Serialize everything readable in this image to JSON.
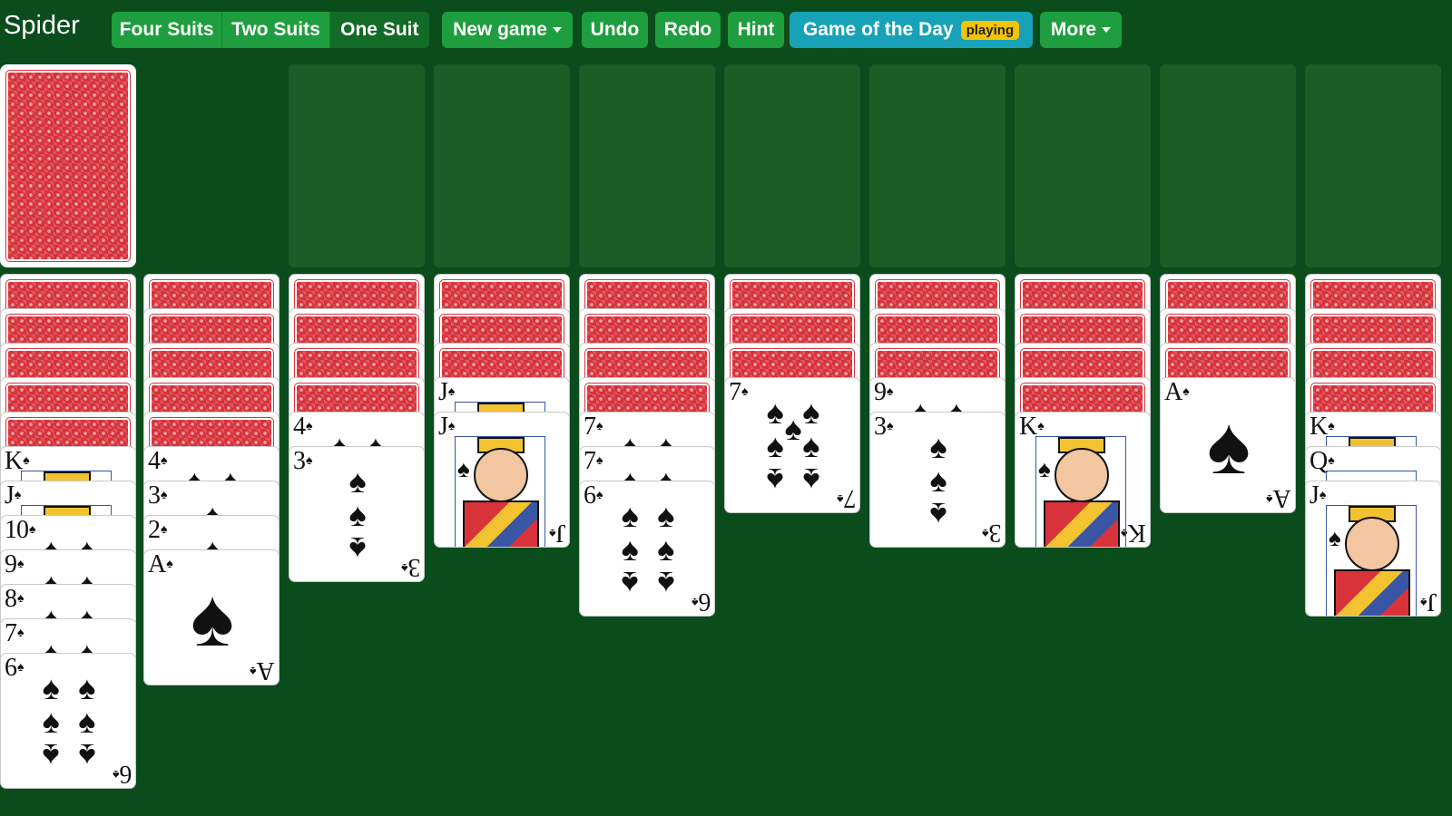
{
  "app": {
    "title": "Spider"
  },
  "toolbar": {
    "suits": [
      {
        "label": "Four Suits"
      },
      {
        "label": "Two Suits"
      },
      {
        "label": "One Suit",
        "active": true
      }
    ],
    "new_game": "New game",
    "undo": "Undo",
    "redo": "Redo",
    "hint": "Hint",
    "game_of_day": "Game of the Day",
    "game_of_day_badge": "playing",
    "more": "More"
  },
  "colors": {
    "table": "#0b4c1c",
    "button": "#1e9e3e",
    "button_active": "#136b28",
    "game_of_day": "#17a2b8",
    "badge": "#f5c400",
    "card_back": "#d8323a",
    "empty_slot": "#1c5c27"
  },
  "suit_symbol": "♠",
  "stock": {
    "face_down": true
  },
  "foundations_empty": 8,
  "tableau": [
    {
      "down": 5,
      "up": [
        "K",
        "J",
        "10",
        "9",
        "8",
        "7",
        "6"
      ]
    },
    {
      "down": 5,
      "up": [
        "4",
        "3",
        "2",
        "A"
      ]
    },
    {
      "down": 4,
      "up": [
        "4",
        "3"
      ]
    },
    {
      "down": 3,
      "up": [
        "J",
        "J"
      ]
    },
    {
      "down": 4,
      "up": [
        "7",
        "7",
        "6"
      ]
    },
    {
      "down": 3,
      "up": [
        "7"
      ]
    },
    {
      "down": 3,
      "up": [
        "9",
        "3"
      ]
    },
    {
      "down": 4,
      "up": [
        "K"
      ]
    },
    {
      "down": 3,
      "up": [
        "A"
      ]
    },
    {
      "down": 4,
      "up": [
        "K",
        "Q",
        "J"
      ]
    }
  ]
}
